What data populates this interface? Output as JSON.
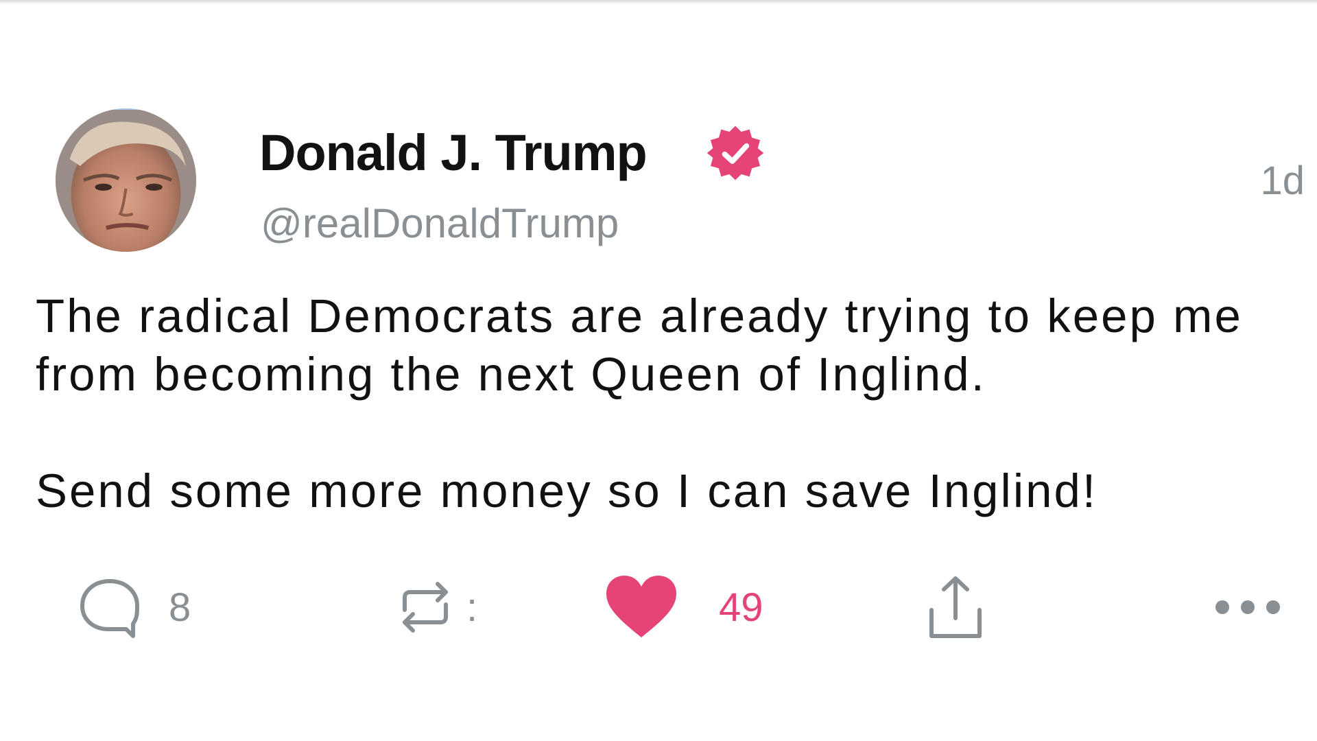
{
  "tweet": {
    "display_name": "Donald J. Trump",
    "handle": "@realDonaldTrump",
    "timestamp": "1d",
    "verified": true,
    "body": [
      "The radical Democrats are already trying to keep me",
      "from becoming the next Queen of Inglind.",
      "Send some more money so I can save Inglind!"
    ]
  },
  "actions": {
    "reply_count": "8",
    "retweet_count": ":",
    "like_count": "49",
    "liked": true
  },
  "icons": {
    "avatar": "profile-photo",
    "verified": "verified-badge-icon",
    "reply": "speech-bubble-icon",
    "retweet": "retweet-arrows-icon",
    "like": "heart-icon",
    "share": "share-upload-icon",
    "more": "more-dots-icon"
  },
  "colors": {
    "accent": "#e0245e",
    "secondary_text": "#8a8f94",
    "primary_text": "#121212"
  }
}
